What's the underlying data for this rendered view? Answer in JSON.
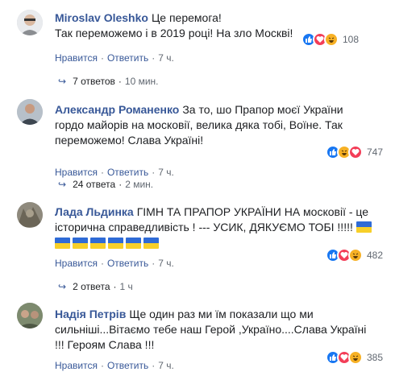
{
  "comments": [
    {
      "author": "Miroslav Oleshko",
      "line1": "Це перемога!",
      "line2": "Так переможемо і в 2019 році! На зло Москві!",
      "reaction_count": "108",
      "like": "Нравится",
      "reply": "Ответить",
      "time": "7 ч.",
      "replies_count": "7 ответов",
      "replies_time": "10 мин."
    },
    {
      "author": "Александр Романенко",
      "line1": "За то, шо Прапор моєї України",
      "line2": "гордо майорів на московії, велика дяка тобі, Воїне. Так",
      "line3": "переможемо! Слава Україні!",
      "reaction_count": "747",
      "like": "Нравится",
      "reply": "Ответить",
      "time": "7 ч.",
      "replies_count": "24 ответа",
      "replies_time": "2 мин."
    },
    {
      "author": "Лада Льдинка",
      "line1": "ГІМН ТА ПРАПОР УКРАЇНИ НА московії - це",
      "line2": "історична справедливість ! --- УСИК, ДЯКУЄМО ТОБІ !!!!!",
      "reaction_count": "482",
      "like": "Нравится",
      "reply": "Ответить",
      "time": "7 ч.",
      "replies_count": "2 ответа",
      "replies_time": "1 ч"
    },
    {
      "author": "Надія Петрів",
      "line1": "Ще один раз ми їм показали що ми",
      "line2": "сильніші...Вітаємо тебе наш Герой ,Україно....Слава Україні",
      "line3": "!!! Героям Слава !!!",
      "reaction_count": "385",
      "like": "Нравится",
      "reply": "Ответить",
      "time": "7 ч."
    }
  ],
  "colors": {
    "link": "#385898",
    "text": "#1c1e21",
    "meta": "#606770",
    "like": "#1877f2",
    "love": "#f33e58",
    "haha": "#f7b125",
    "flag_blue": "#2f6bd6",
    "flag_yellow": "#f7cf29"
  },
  "icons": [
    "like-icon",
    "love-icon",
    "haha-icon",
    "reply-arrow-icon",
    "ukraine-flag-emoji"
  ]
}
